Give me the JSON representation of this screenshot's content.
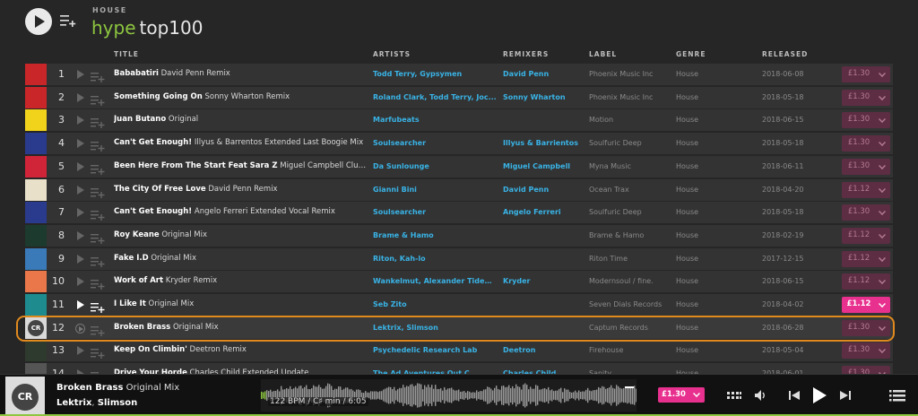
{
  "header": {
    "genre": "HOUSE",
    "brand_hype": "hype",
    "brand_top": "top100"
  },
  "columns": {
    "title": "TITLE",
    "artists": "ARTISTS",
    "remixers": "REMIXERS",
    "label": "LABEL",
    "genre": "GENRE",
    "released": "RELEASED"
  },
  "tracks": [
    {
      "num": "1",
      "title": "Bababatiri",
      "mix": "David Penn Remix",
      "artists": "Todd Terry, Gypsymen",
      "remixers": "David Penn",
      "label": "Phoenix Music Inc",
      "genre": "House",
      "released": "2018-06-08",
      "price": "£1.30",
      "art_color": "#c9262a"
    },
    {
      "num": "2",
      "title": "Something Going On",
      "mix": "Sonny Wharton Remix",
      "artists": "Roland Clark, Todd Terry, Joc...",
      "remixers": "Sonny Wharton",
      "label": "Phoenix Music Inc",
      "genre": "House",
      "released": "2018-05-18",
      "price": "£1.30",
      "art_color": "#c9262a"
    },
    {
      "num": "3",
      "title": "Juan Butano",
      "mix": "Original",
      "artists": "Marfubeats",
      "remixers": "",
      "label": "Motion",
      "genre": "House",
      "released": "2018-06-15",
      "price": "£1.30",
      "art_color": "#f2d31b"
    },
    {
      "num": "4",
      "title": "Can't Get Enough!",
      "mix": "Illyus & Barrentos Extended Last Boogie Mix",
      "artists": "Soulsearcher",
      "remixers": "Illyus & Barrientos",
      "label": "Soulfuric Deep",
      "genre": "House",
      "released": "2018-05-18",
      "price": "£1.30",
      "art_color": "#2a3a8c"
    },
    {
      "num": "5",
      "title": "Been Here From The Start Feat Sara Z",
      "mix": "Miguel Campbell Club...",
      "artists": "Da Sunlounge",
      "remixers": "Miguel Campbell",
      "label": "Myna Music",
      "genre": "House",
      "released": "2018-06-11",
      "price": "£1.30",
      "art_color": "#d02438"
    },
    {
      "num": "6",
      "title": "The City Of Free Love",
      "mix": "David Penn Remix",
      "artists": "Gianni Bini",
      "remixers": "David Penn",
      "label": "Ocean Trax",
      "genre": "House",
      "released": "2018-04-20",
      "price": "£1.12",
      "art_color": "#e8e0c8"
    },
    {
      "num": "7",
      "title": "Can't Get Enough!",
      "mix": "Angelo Ferreri Extended Vocal Remix",
      "artists": "Soulsearcher",
      "remixers": "Angelo Ferreri",
      "label": "Soulfuric Deep",
      "genre": "House",
      "released": "2018-05-18",
      "price": "£1.30",
      "art_color": "#2a3a8c"
    },
    {
      "num": "8",
      "title": "Roy Keane",
      "mix": "Original Mix",
      "artists": "Brame & Hamo",
      "remixers": "",
      "label": "Brame & Hamo",
      "genre": "House",
      "released": "2018-02-19",
      "price": "£1.12",
      "art_color": "#1d3a2e"
    },
    {
      "num": "9",
      "title": "Fake I.D",
      "mix": "Original Mix",
      "artists": "Riton, Kah-lo",
      "remixers": "",
      "label": "Riton Time",
      "genre": "House",
      "released": "2017-12-15",
      "price": "£1.12",
      "art_color": "#3a7ab8"
    },
    {
      "num": "10",
      "title": "Work of Art",
      "mix": "Kryder Remix",
      "artists": "Wankelmut, Alexander Tideb...",
      "remixers": "Kryder",
      "label": "Modernsoul / fine.",
      "genre": "House",
      "released": "2018-06-15",
      "price": "£1.12",
      "art_color": "#e9774a"
    },
    {
      "num": "11",
      "title": "I Like It",
      "mix": "Original Mix",
      "artists": "Seb Zito",
      "remixers": "",
      "label": "Seven Dials Records",
      "genre": "House",
      "released": "2018-04-02",
      "price": "£1.12",
      "art_color": "#1e8c8f"
    },
    {
      "num": "12",
      "title": "Broken Brass",
      "mix": "Original Mix",
      "artists": "Lektrix, Slimson",
      "remixers": "",
      "label": "Captum Records",
      "genre": "House",
      "released": "2018-06-28",
      "price": "£1.30",
      "art_color": "#d9d9d9"
    },
    {
      "num": "13",
      "title": "Keep On Climbin'",
      "mix": "Deetron Remix",
      "artists": "Psychedelic Research Lab",
      "remixers": "Deetron",
      "label": "Firehouse",
      "genre": "House",
      "released": "2018-05-04",
      "price": "£1.30",
      "art_color": "#2d3a2d"
    },
    {
      "num": "14",
      "title": "Drive Your Horde",
      "mix": "Charles Child Extended Update",
      "artists": "The Ad Aventures Out C...",
      "remixers": "Charles Child",
      "label": "Sanity",
      "genre": "House",
      "released": "2018-06-01",
      "price": "£1.30",
      "art_color": "#555"
    }
  ],
  "player": {
    "title": "Broken Brass",
    "mix": "Original Mix",
    "artist1": "Lektrix",
    "artist_sep": ", ",
    "artist2": "Slimson",
    "wave_info": "122 BPM / C♯ min / 6:05",
    "price": "£1.30",
    "cover_logo": "CR"
  },
  "colors": {
    "accent_green": "#8dc63f",
    "link_blue": "#39b3e6",
    "buy_pink": "#e8308e",
    "highlight_orange": "#e08a1e"
  }
}
